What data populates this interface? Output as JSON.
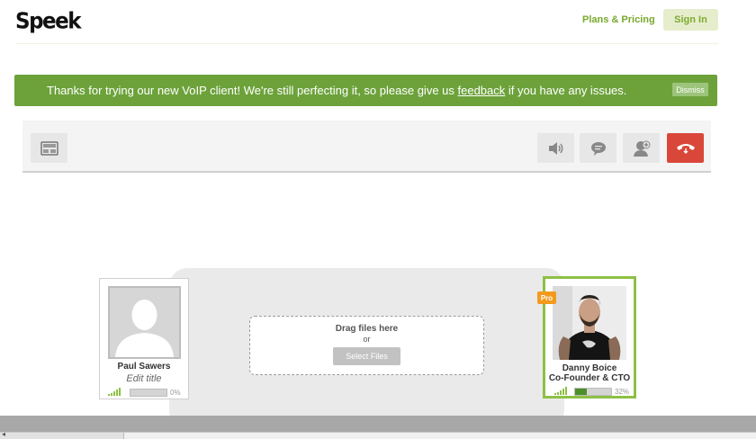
{
  "header": {
    "logo": "Speek",
    "plans_label": "Plans & Pricing",
    "sign_in_label": "Sign In"
  },
  "banner": {
    "text_before": "Thanks for trying our new VoIP client! We're still perfecting it, so please give us ",
    "link_text": "feedback",
    "text_after": " if you have any issues.",
    "dismiss_label": "Dismiss",
    "color": "#6da23b"
  },
  "toolbar": {
    "left_button_icon": "screen-share-icon",
    "right_buttons": [
      "speaker-icon",
      "chat-icon",
      "add-user-icon",
      "end-call-icon"
    ],
    "end_call_color": "#d9473a"
  },
  "dropzone": {
    "title": "Drag files here",
    "or": "or",
    "button_label": "Select Files"
  },
  "participants": {
    "me": {
      "name": "Paul Sawers",
      "title_placeholder": "Edit title",
      "volume_percent_label": "0%",
      "volume_fraction": 0
    },
    "other": {
      "badge": "Pro",
      "name": "Danny Boice",
      "role": "Co-Founder & CTO",
      "volume_percent_label": "32%",
      "volume_fraction": 0.32,
      "accent": "#8dc045"
    }
  }
}
